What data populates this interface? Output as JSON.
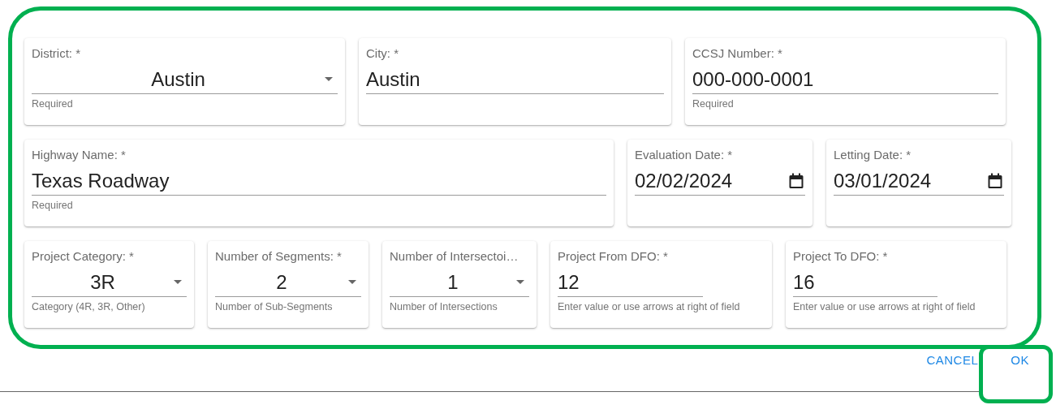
{
  "rows": [
    {
      "fields": [
        {
          "kind": "select",
          "label": "District: *",
          "value": "Austin",
          "helper": "Required"
        },
        {
          "kind": "text",
          "label": "City: *",
          "value": "Austin"
        },
        {
          "kind": "text",
          "label": "CCSJ Number: *",
          "value": "000-000-0001",
          "helper": "Required"
        }
      ]
    },
    {
      "fields": [
        {
          "kind": "text",
          "label": "Highway Name: *",
          "value": "Texas Roadway",
          "helper": "Required"
        },
        {
          "kind": "date",
          "label": "Evaluation Date: *",
          "value": "02/02/2024"
        },
        {
          "kind": "date",
          "label": "Letting Date: *",
          "value": "03/01/2024"
        }
      ]
    },
    {
      "fields": [
        {
          "kind": "select",
          "label": "Project Category: *",
          "value": "3R",
          "helper": "Category (4R, 3R, Other)"
        },
        {
          "kind": "select",
          "label": "Number of Segments: *",
          "value": "2",
          "helper": "Number of Sub-Segments"
        },
        {
          "kind": "select",
          "label": "Number of Intersectoi…",
          "value": "1",
          "helper": "Number of Intersections"
        },
        {
          "kind": "number",
          "label": "Project From DFO: *",
          "value": "12",
          "helper": "Enter value or use arrows at right of field"
        },
        {
          "kind": "number",
          "label": "Project To DFO: *",
          "value": "16",
          "helper": "Enter value or use arrows at right of field"
        }
      ]
    }
  ],
  "buttons": [
    {
      "label": "CANCEL"
    },
    {
      "label": "OK"
    }
  ]
}
